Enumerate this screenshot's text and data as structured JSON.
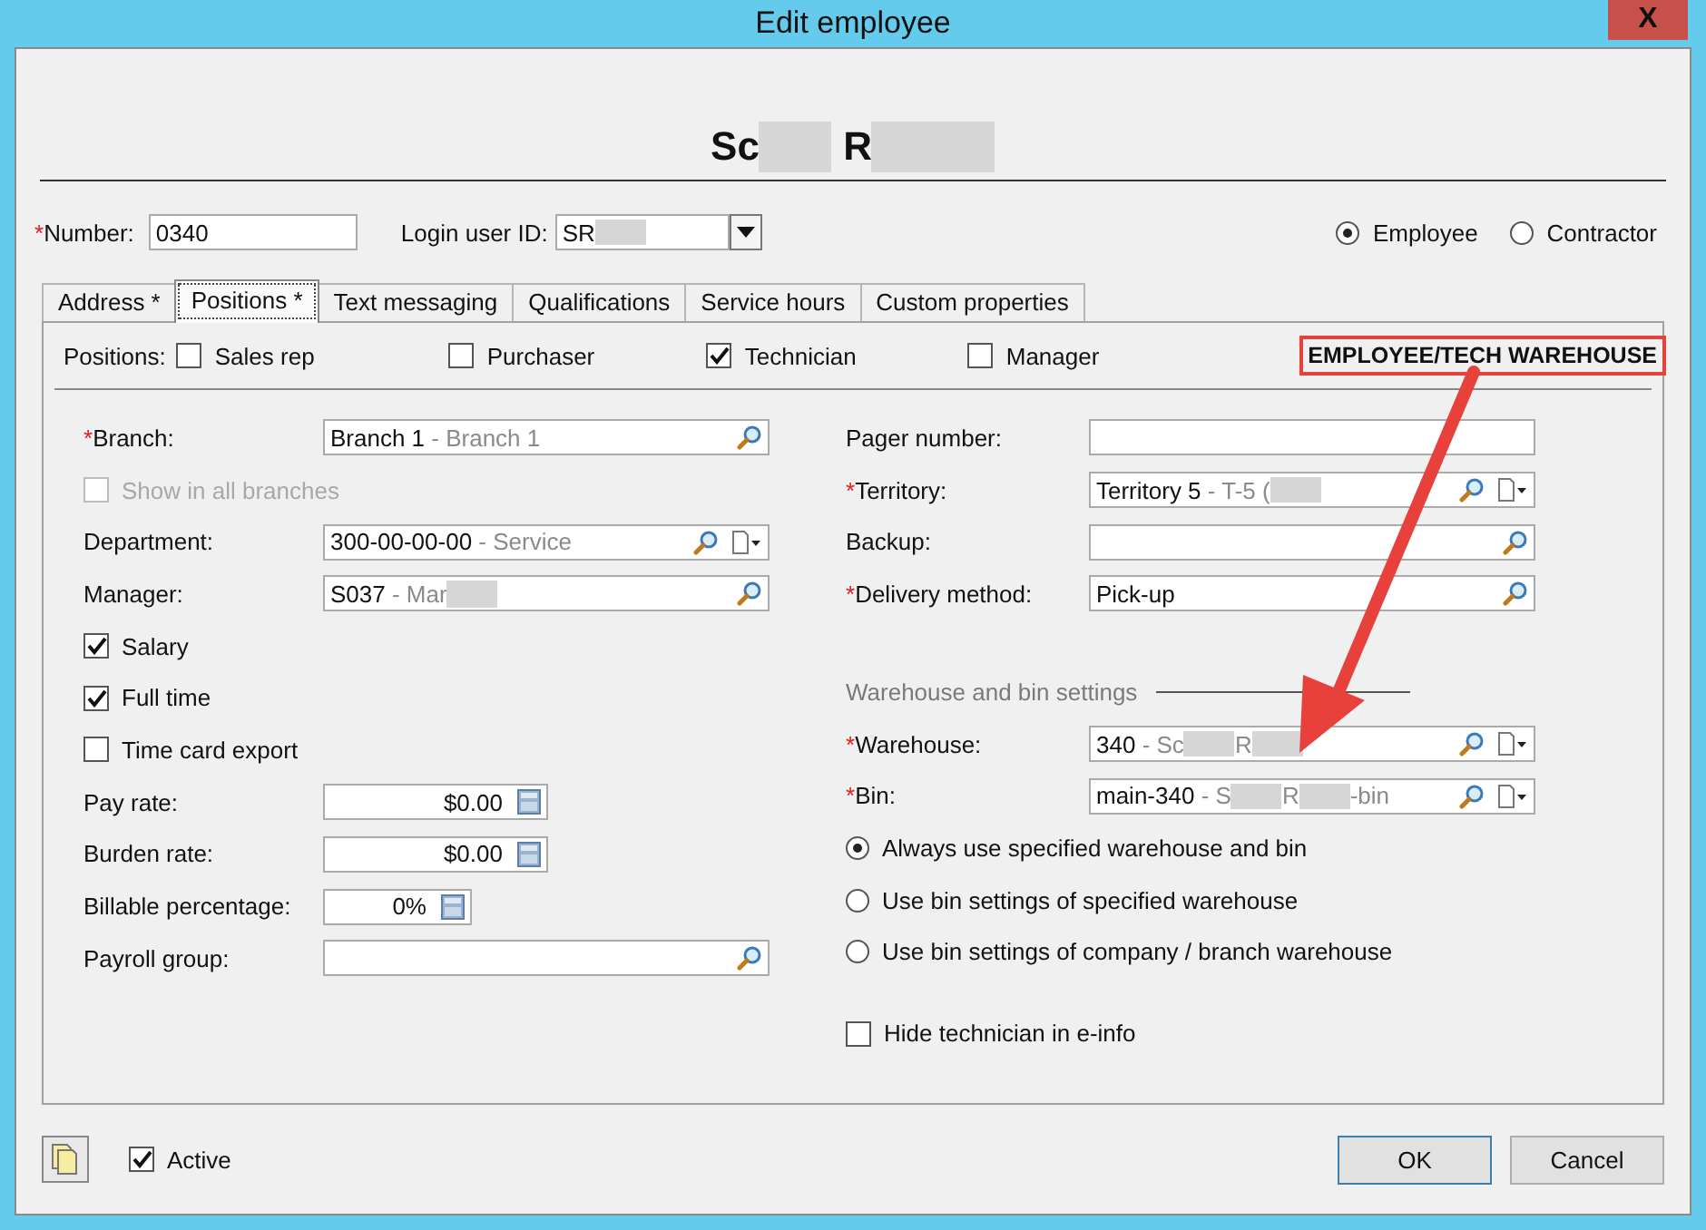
{
  "window": {
    "title": "Edit employee",
    "close": "X"
  },
  "header": {
    "parts": [
      {
        "kind": "text",
        "text": "Sc"
      },
      {
        "kind": "redaction"
      },
      {
        "kind": "text",
        "text": " R"
      },
      {
        "kind": "redaction"
      }
    ]
  },
  "number": {
    "label": "Number:",
    "required": "*",
    "value": "0340"
  },
  "login": {
    "label": "Login user ID:",
    "parts": [
      {
        "kind": "text",
        "text": "SR"
      },
      {
        "kind": "redaction"
      }
    ]
  },
  "type_options": [
    {
      "label": "Employee",
      "selected": true
    },
    {
      "label": "Contractor",
      "selected": false
    }
  ],
  "tabs": [
    {
      "label": "Address *",
      "selected": false
    },
    {
      "label": "Positions *",
      "selected": true
    },
    {
      "label": "Text messaging",
      "selected": false
    },
    {
      "label": "Qualifications",
      "selected": false
    },
    {
      "label": "Service hours",
      "selected": false
    },
    {
      "label": "Custom properties",
      "selected": false
    }
  ],
  "positions": {
    "label": "Positions:",
    "items": [
      {
        "label": "Sales rep",
        "checked": false
      },
      {
        "label": "Purchaser",
        "checked": false
      },
      {
        "label": "Technician",
        "checked": true
      },
      {
        "label": "Manager",
        "checked": false
      }
    ]
  },
  "annotation": {
    "label": "EMPLOYEE/TECH WAREHOUSE"
  },
  "left_rows": [
    {
      "kind": "lookup",
      "label": "Branch:",
      "required": "*",
      "parts": [
        {
          "kind": "text",
          "text": "Branch 1"
        },
        {
          "kind": "muted",
          "text": " - Branch 1"
        }
      ],
      "search": true
    },
    {
      "kind": "checkbox",
      "label": "Show in all branches",
      "checked": false,
      "disabled": true
    },
    {
      "kind": "lookup",
      "label": "Department:",
      "parts": [
        {
          "kind": "text",
          "text": "300-00-00-00"
        },
        {
          "kind": "muted",
          "text": " - Service"
        }
      ],
      "search": true,
      "menu": true
    },
    {
      "kind": "lookup",
      "label": "Manager:",
      "parts": [
        {
          "kind": "text",
          "text": "S037"
        },
        {
          "kind": "muted",
          "text": " - Mar"
        },
        {
          "kind": "redaction"
        }
      ],
      "search": true
    },
    {
      "kind": "checkbox",
      "label": "Salary",
      "checked": true,
      "disabled": false
    },
    {
      "kind": "checkbox",
      "label": "Full time",
      "checked": true,
      "disabled": false
    },
    {
      "kind": "checkbox",
      "label": "Time card export",
      "checked": false,
      "disabled": false
    },
    {
      "kind": "amount",
      "label": "Pay rate:",
      "value": "$0.00"
    },
    {
      "kind": "amount",
      "label": "Burden rate:",
      "value": "$0.00"
    },
    {
      "kind": "percent",
      "label": "Billable percentage:",
      "value": "0%"
    },
    {
      "kind": "lookup",
      "label": "Payroll group:",
      "parts": [],
      "search": true
    }
  ],
  "right_rows": [
    {
      "kind": "lookup",
      "label": "Pager number:",
      "parts": []
    },
    {
      "kind": "lookup",
      "label": "Territory:",
      "required": "*",
      "parts": [
        {
          "kind": "text",
          "text": "Territory 5"
        },
        {
          "kind": "muted",
          "text": " - T-5 ("
        },
        {
          "kind": "redaction"
        }
      ],
      "search": true,
      "menu": true
    },
    {
      "kind": "lookup",
      "label": "Backup:",
      "parts": [],
      "search": true
    },
    {
      "kind": "lookup",
      "label": "Delivery method:",
      "required": "*",
      "parts": [
        {
          "kind": "text",
          "text": "Pick-up"
        }
      ],
      "search": true
    },
    {
      "kind": "section",
      "label": "Warehouse and bin settings"
    },
    {
      "kind": "lookup",
      "label": "Warehouse:",
      "required": "*",
      "parts": [
        {
          "kind": "text",
          "text": "340"
        },
        {
          "kind": "muted",
          "text": " - Sc"
        },
        {
          "kind": "redaction"
        },
        {
          "kind": "muted",
          "text": "R"
        },
        {
          "kind": "redaction"
        }
      ],
      "search": true,
      "menu": true
    },
    {
      "kind": "lookup",
      "label": "Bin:",
      "required": "*",
      "parts": [
        {
          "kind": "text",
          "text": "main-340"
        },
        {
          "kind": "muted",
          "text": " - S"
        },
        {
          "kind": "redaction"
        },
        {
          "kind": "muted",
          "text": "R"
        },
        {
          "kind": "redaction"
        },
        {
          "kind": "muted",
          "text": "-bin"
        }
      ],
      "search": true,
      "menu": true
    },
    {
      "kind": "radio",
      "label": "Always use specified warehouse and bin",
      "selected": true
    },
    {
      "kind": "radio",
      "label": "Use bin settings of specified warehouse",
      "selected": false
    },
    {
      "kind": "radio",
      "label": "Use bin settings of company / branch warehouse",
      "selected": false
    },
    {
      "kind": "gap"
    },
    {
      "kind": "checkbox",
      "label": "Hide technician in e-info",
      "checked": false,
      "disabled": false
    }
  ],
  "footer": {
    "active": {
      "label": "Active",
      "checked": true
    },
    "buttons": [
      {
        "label": "OK",
        "default": true
      },
      {
        "label": "Cancel",
        "default": false
      }
    ]
  }
}
